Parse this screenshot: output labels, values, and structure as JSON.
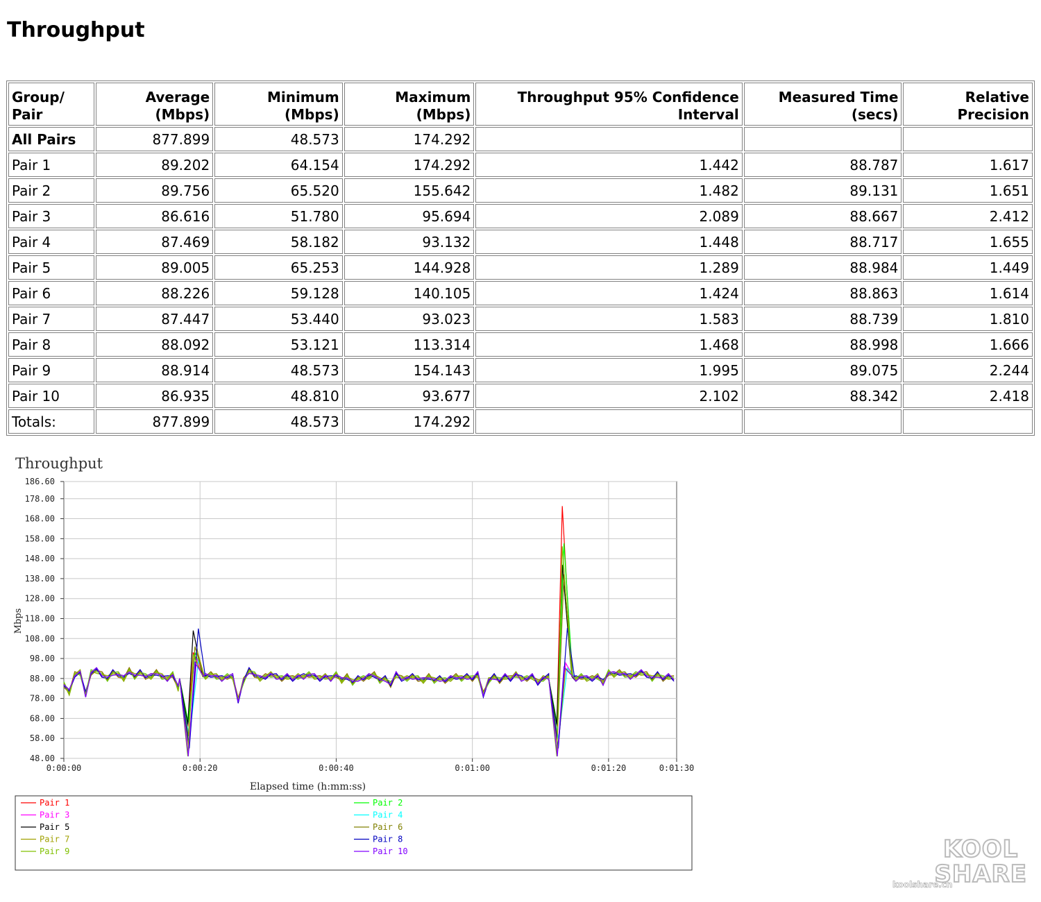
{
  "page_title": "Throughput",
  "table": {
    "headers": [
      {
        "text": "Group/\nPair",
        "align": "lft"
      },
      {
        "text": "Average (Mbps)",
        "align": "num"
      },
      {
        "text": "Minimum (Mbps)",
        "align": "num"
      },
      {
        "text": "Maximum (Mbps)",
        "align": "num"
      },
      {
        "text": "Throughput 95% Confidence Interval",
        "align": "num"
      },
      {
        "text": "Measured Time (secs)",
        "align": "num"
      },
      {
        "text": "Relative Precision",
        "align": "num"
      }
    ],
    "rows": [
      {
        "cells": [
          "All Pairs",
          "877.899",
          "48.573",
          "174.292",
          "",
          "",
          ""
        ],
        "bold": true
      },
      {
        "cells": [
          "Pair 1",
          "89.202",
          "64.154",
          "174.292",
          "1.442",
          "88.787",
          "1.617"
        ]
      },
      {
        "cells": [
          "Pair 2",
          "89.756",
          "65.520",
          "155.642",
          "1.482",
          "89.131",
          "1.651"
        ]
      },
      {
        "cells": [
          "Pair 3",
          "86.616",
          "51.780",
          "95.694",
          "2.089",
          "88.667",
          "2.412"
        ]
      },
      {
        "cells": [
          "Pair 4",
          "87.469",
          "58.182",
          "93.132",
          "1.448",
          "88.717",
          "1.655"
        ]
      },
      {
        "cells": [
          "Pair 5",
          "89.005",
          "65.253",
          "144.928",
          "1.289",
          "88.984",
          "1.449"
        ]
      },
      {
        "cells": [
          "Pair 6",
          "88.226",
          "59.128",
          "140.105",
          "1.424",
          "88.863",
          "1.614"
        ]
      },
      {
        "cells": [
          "Pair 7",
          "87.447",
          "53.440",
          "93.023",
          "1.583",
          "88.739",
          "1.810"
        ]
      },
      {
        "cells": [
          "Pair 8",
          "88.092",
          "53.121",
          "113.314",
          "1.468",
          "88.998",
          "1.666"
        ]
      },
      {
        "cells": [
          "Pair 9",
          "88.914",
          "48.573",
          "154.143",
          "1.995",
          "89.075",
          "2.244"
        ]
      },
      {
        "cells": [
          "Pair 10",
          "86.935",
          "48.810",
          "93.677",
          "2.102",
          "88.342",
          "2.418"
        ]
      },
      {
        "cells": [
          "Totals:",
          "877.899",
          "48.573",
          "174.292",
          "",
          "",
          ""
        ]
      }
    ]
  },
  "chart_data": {
    "type": "line",
    "title": "Throughput",
    "xlabel": "Elapsed time (h:mm:ss)",
    "ylabel": "Mbps",
    "xlim": [
      0,
      90
    ],
    "ylim": [
      48.0,
      186.6
    ],
    "y_ticks": [
      "186.60",
      "178.00",
      "168.00",
      "158.00",
      "148.00",
      "138.00",
      "128.00",
      "118.00",
      "108.00",
      "98.00",
      "88.00",
      "78.00",
      "68.00",
      "58.00",
      "48.00"
    ],
    "y_tick_values": [
      186.6,
      178,
      168,
      158,
      148,
      138,
      128,
      118,
      108,
      98,
      88,
      78,
      68,
      58,
      48
    ],
    "x_ticks": [
      "0:00:00",
      "0:00:20",
      "0:00:40",
      "0:01:00",
      "0:01:20",
      "0:01:30"
    ],
    "x_tick_values": [
      0,
      20,
      40,
      60,
      80,
      90
    ],
    "grid": true,
    "legend_position": "bottom",
    "baseline": {
      "x": [
        0,
        0.8,
        1.6,
        2.4,
        3.2,
        4.0,
        4.8,
        5.6,
        6.4,
        7.2,
        8.0,
        8.8,
        9.6,
        10.4,
        11.2,
        12.0,
        12.8,
        13.6,
        14.4,
        15.2,
        16.0,
        16.8,
        17.6,
        18.4,
        19.2,
        20.0,
        20.8,
        21.6,
        22.4,
        23.2,
        24.0,
        24.8,
        25.6,
        26.4,
        27.2,
        28.0,
        28.8,
        29.6,
        30.4,
        31.2,
        32.0,
        32.8,
        33.6,
        34.4,
        35.2,
        36.0,
        36.8,
        37.6,
        38.4,
        39.2,
        40.0,
        40.8,
        41.6,
        42.4,
        43.2,
        44.0,
        44.8,
        45.6,
        46.4,
        47.2,
        48.0,
        48.8,
        49.6,
        50.4,
        51.2,
        52.0,
        52.8,
        53.6,
        54.4,
        55.2,
        56.0,
        56.8,
        57.6,
        58.4,
        59.2,
        60.0,
        60.8,
        61.6,
        62.4,
        63.2,
        64.0,
        64.8,
        65.6,
        66.4,
        67.2,
        68.0,
        68.8,
        69.6,
        70.4,
        71.2,
        72.0,
        72.8,
        73.6,
        74.4,
        75.2,
        76.0,
        76.8,
        77.6,
        78.4,
        79.2,
        80.0,
        80.8,
        81.6,
        82.4,
        83.2,
        84.0,
        84.8,
        85.6,
        86.4,
        87.2,
        88.0,
        88.8,
        89.6
      ],
      "y": [
        85,
        81,
        90,
        91,
        80,
        91,
        92,
        90,
        88,
        91,
        90,
        88,
        92,
        89,
        91,
        89,
        89,
        91,
        89,
        88,
        90,
        83,
        88,
        91,
        84,
        92,
        89,
        90,
        89,
        88,
        89,
        89,
        77,
        87,
        92,
        90,
        88,
        89,
        90,
        89,
        88,
        89,
        88,
        89,
        89,
        90,
        89,
        88,
        89,
        88,
        90,
        87,
        89,
        86,
        88,
        88,
        89,
        90,
        87,
        88,
        85,
        90,
        88,
        88,
        89,
        88,
        87,
        89,
        87,
        88,
        87,
        88,
        89,
        88,
        89,
        88,
        90,
        80,
        87,
        89,
        87,
        89,
        88,
        90,
        88,
        88,
        89,
        86,
        88,
        89,
        88,
        88,
        91,
        88,
        88,
        89,
        88,
        88,
        89,
        86,
        91,
        90,
        91,
        90,
        89,
        90,
        91,
        90,
        88,
        90,
        88,
        89,
        88
      ]
    },
    "dips": [
      {
        "center": 18.2,
        "min": [
          64,
          66,
          52,
          58,
          65,
          59,
          53,
          53,
          49,
          49
        ],
        "peak": [
          101,
          101,
          98,
          97,
          112,
          104,
          103,
          113,
          100,
          96
        ],
        "peakAt": 19.0
      },
      {
        "center": 72.4,
        "min": [
          64,
          65,
          52,
          58,
          65,
          59,
          53,
          53,
          49,
          49
        ],
        "peak": [
          174.292,
          155.642,
          95.694,
          93.132,
          144.928,
          140.105,
          93.023,
          113.314,
          154.143,
          93.677
        ],
        "peakAt": 73.2
      }
    ],
    "series": [
      {
        "name": "Pair 1",
        "color": "#ff0000"
      },
      {
        "name": "Pair 2",
        "color": "#00ff00"
      },
      {
        "name": "Pair 3",
        "color": "#ff00ff"
      },
      {
        "name": "Pair 4",
        "color": "#00ffff"
      },
      {
        "name": "Pair 5",
        "color": "#000000"
      },
      {
        "name": "Pair 6",
        "color": "#808000"
      },
      {
        "name": "Pair 7",
        "color": "#a0a000"
      },
      {
        "name": "Pair 8",
        "color": "#0000c0"
      },
      {
        "name": "Pair 9",
        "color": "#80c000"
      },
      {
        "name": "Pair 10",
        "color": "#8000ff"
      }
    ]
  },
  "watermark": {
    "logo_top": "KOOL",
    "logo_bottom": "SHARE",
    "site": "koolshare.cn"
  }
}
